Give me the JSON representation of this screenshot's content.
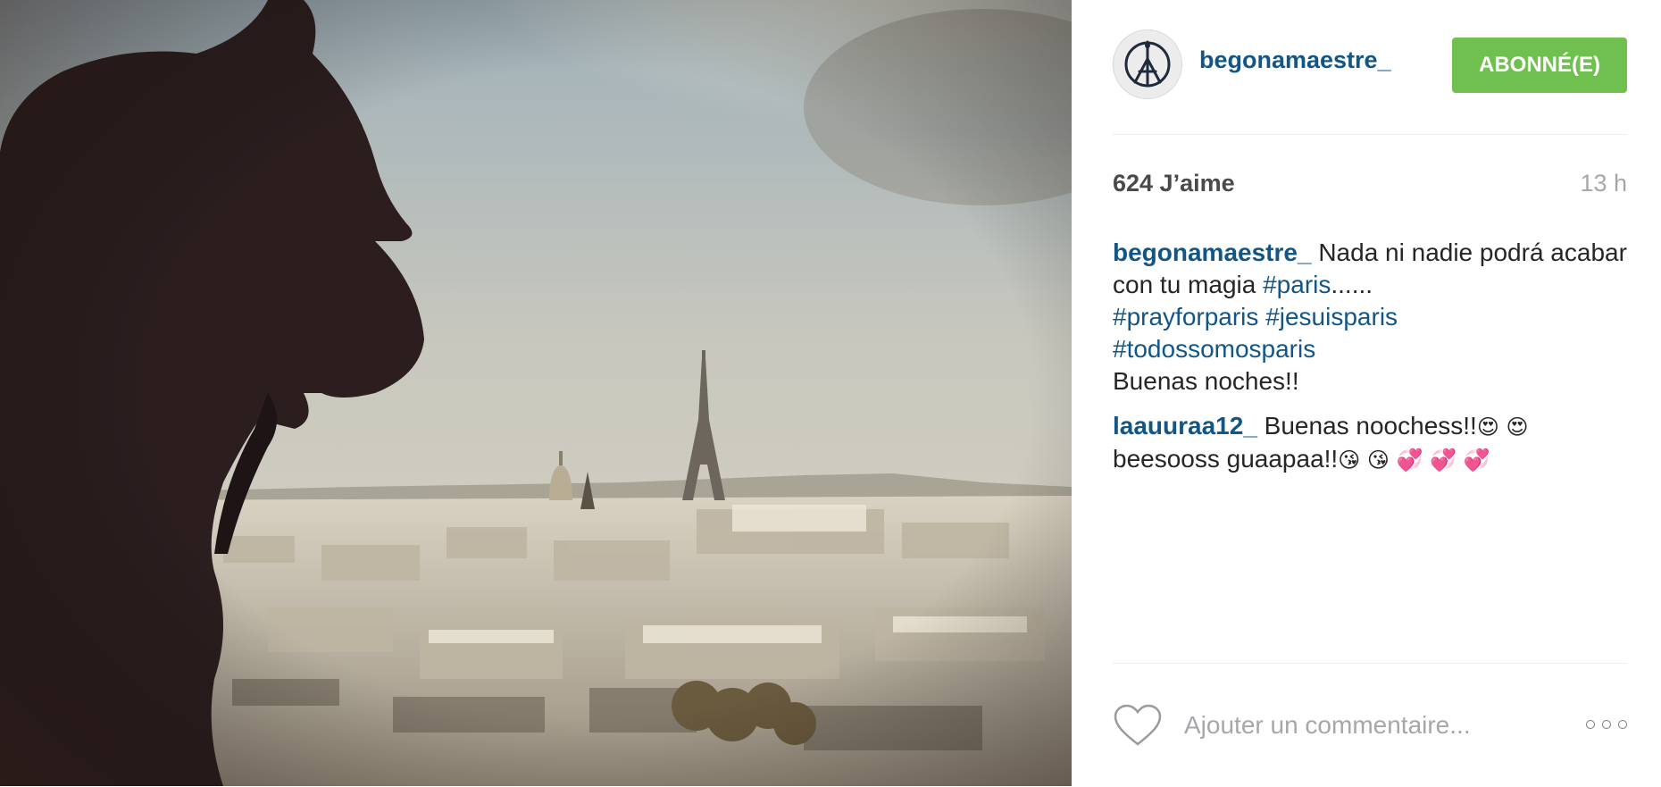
{
  "post": {
    "author": "begonamaestre_",
    "follow_label": "ABONNÉ(E)",
    "likes": "624 J’aime",
    "time": "13 h",
    "caption": {
      "user": "begonamaestre_",
      "text_1": "Nada ni nadie podrá acabar con tu magia",
      "tag_paris": "#paris",
      "dots": "......",
      "tag_prayforparis": "#prayforparis",
      "tag_jesuisparis": "#jesuisparis",
      "tag_todossomosparis": "#todossomosparis",
      "closing": "Buenas noches!!"
    },
    "comments": [
      {
        "user": "laauuraa12_",
        "text_1": "Buenas noochess!!",
        "emoji_1": "😍 😍",
        "text_2": "beesooss guaapaa!!",
        "emoji_2": "😘 😘 💞 💞 💞"
      }
    ],
    "comment_placeholder": "Ajouter un commentaire...",
    "icons": {
      "avatar": "peace-for-paris-icon",
      "like": "heart-icon",
      "more": "more-options-icon"
    },
    "colors": {
      "link": "#125688",
      "follow_button": "#70c050",
      "muted": "#a5a7aa"
    }
  }
}
